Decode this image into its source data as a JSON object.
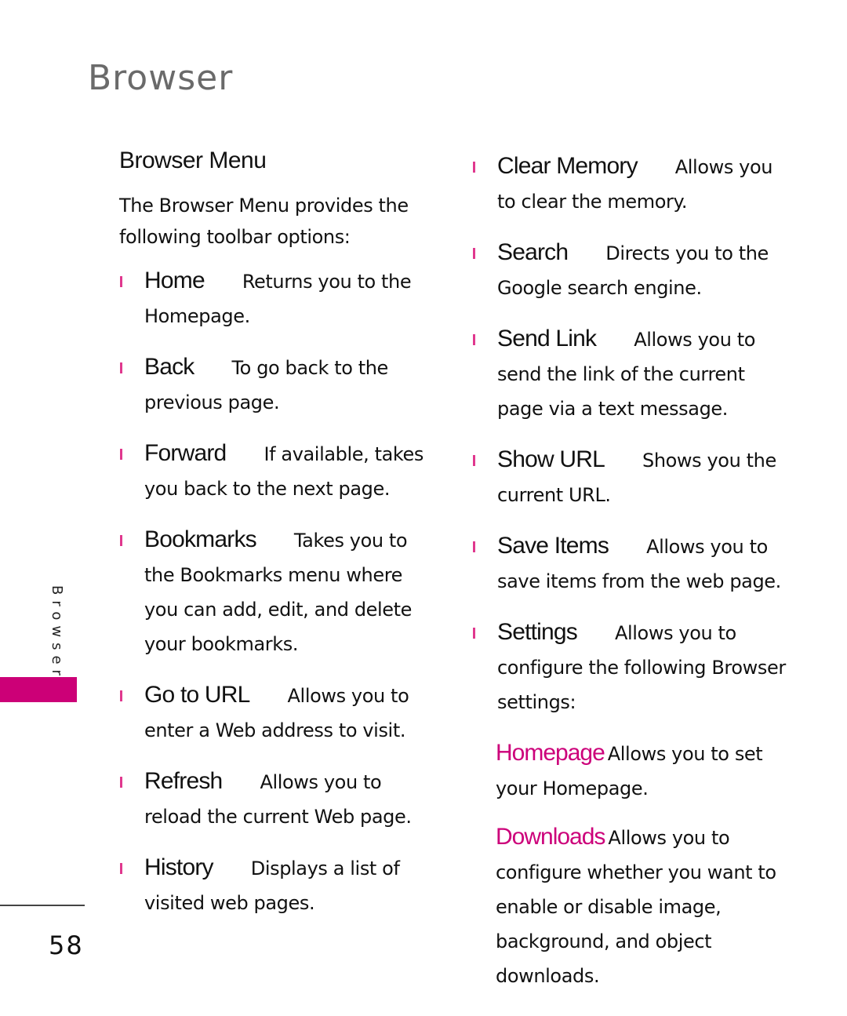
{
  "header": {
    "chapter_title": "Browser"
  },
  "section": {
    "title": "Browser Menu",
    "intro": "The Browser Menu provides the following toolbar options:"
  },
  "left_items": [
    {
      "term": "Home",
      "description": "Returns you to the Homepage."
    },
    {
      "term": "Back",
      "description": "To go back to the previous page."
    },
    {
      "term": "Forward",
      "description": "If available, takes you back to the next page."
    },
    {
      "term": "Bookmarks",
      "description": "Takes you to the Bookmarks menu where you can add, edit, and delete your bookmarks."
    },
    {
      "term": "Go to URL",
      "description": "Allows you to enter a Web address to visit."
    },
    {
      "term": "Refresh",
      "description": "Allows you to reload the current Web page."
    },
    {
      "term": "History",
      "description": "Displays a list of visited web pages."
    }
  ],
  "right_items": [
    {
      "term": "Clear Memory",
      "description": "Allows you to clear the memory."
    },
    {
      "term": "Search",
      "description": "Directs you to the Google search engine."
    },
    {
      "term": "Send Link",
      "description": "Allows you to send the link of the current page via a text message."
    },
    {
      "term": "Show URL",
      "description": "Shows you the current URL."
    },
    {
      "term": "Save Items",
      "description": "Allows you to save items from the web page."
    },
    {
      "term": "Settings",
      "description": "Allows you to configure the following Browser settings:"
    }
  ],
  "settings_subitems": [
    {
      "term": "Homepage",
      "description": "Allows you to set your Homepage."
    },
    {
      "term": "Downloads",
      "description": "Allows you to configure whether you want to enable or disable image, background, and object downloads."
    }
  ],
  "sidebar": {
    "label": "Browser"
  },
  "footer": {
    "page_number": "58"
  },
  "colors": {
    "accent": "#cc0077",
    "bullet": "#e0388e",
    "title_gray": "#6a6a6a"
  }
}
